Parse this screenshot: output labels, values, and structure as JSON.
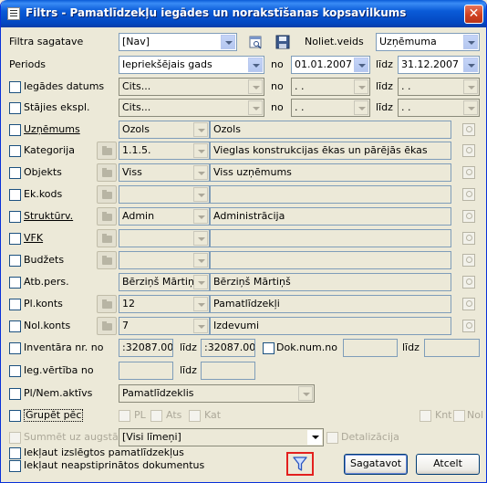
{
  "window": {
    "title": "Filtrs - Pamatlīdzekļu iegādes un norakstīšanas kopsavilkums",
    "close_glyph": "✕"
  },
  "filtra_sagatave": {
    "label": "Filtra sagatave",
    "value": "[Nav]"
  },
  "noliet_veids": {
    "label": "Noliet.veids",
    "value": "Uzņēmuma"
  },
  "periods": {
    "label": "Periods",
    "value": "Iepriekšējais gads",
    "no_label": "no",
    "from": "01.01.2007",
    "lidz_label": "līdz",
    "to": "31.12.2007"
  },
  "iegades_datums": {
    "label": "Iegādes datums",
    "value": "Cits...",
    "no_label": "no",
    "from": " .  . ",
    "lidz_label": "līdz",
    "to": " .  . "
  },
  "stajies_ekspl": {
    "label": "Stājies ekspl.",
    "value": "Cits...",
    "no_label": "no",
    "from": " .  . ",
    "lidz_label": "līdz",
    "to": " .  . "
  },
  "rows": {
    "uznemums": {
      "label": "Uzņēmums",
      "code": "Ozols",
      "name": "Ozols"
    },
    "kategorija": {
      "label": "Kategorija",
      "code": "1.1.5.",
      "name": "Vieglas konstrukcijas ēkas un pārējās ēkas"
    },
    "objekts": {
      "label": "Objekts",
      "code": "Viss",
      "name": "Viss uzņēmums"
    },
    "ek_kods": {
      "label": "Ek.kods",
      "code": "",
      "name": ""
    },
    "strukturv": {
      "label": "Struktūrv.",
      "code": "Admin",
      "name": "Administrācija"
    },
    "vfk": {
      "label": "VFK",
      "code": "",
      "name": ""
    },
    "budzets": {
      "label": "Budžets",
      "code": "",
      "name": ""
    },
    "atb_pers": {
      "label": "Atb.pers.",
      "code": "Bērziņš Mārtiņš",
      "name": "Bērziņš Mārtiņš"
    },
    "pl_konts": {
      "label": "Pl.konts",
      "code": "12",
      "name": "Pamatlīdzekļi"
    },
    "nol_konts": {
      "label": "Nol.konts",
      "code": "7",
      "name": "Izdevumi"
    }
  },
  "inventara_nr": {
    "label": "Inventāra nr. no",
    "from": ":32087.000",
    "lidz_label": "līdz",
    "to": ":32087.000"
  },
  "dok_num": {
    "label": "Dok.num.no",
    "from": "",
    "lidz_label": "līdz",
    "to": ""
  },
  "ieg_vertiba": {
    "label": "Ieg.vērtība no",
    "from": "",
    "lidz_label": "līdz",
    "to": ""
  },
  "pl_nem_aktivs": {
    "label": "Pl/Nem.aktīvs",
    "value": "Pamatlīdzeklis"
  },
  "grupet_pec": {
    "label": "Grupēt pēc",
    "opt_pl": "PL",
    "opt_ats": "Ats",
    "opt_kat": "Kat",
    "opt_knt": "Knt",
    "opt_nol": "Nol"
  },
  "summet": {
    "label": "Summēt uz augstāko",
    "value": "[Visi līmeņi]",
    "detalizacija": "Detalizācija"
  },
  "iekl_izslegtos": {
    "label": "Iekļaut izslēgtos pamatlīdzekļus"
  },
  "iekl_neapst": {
    "label": "Iekļaut neapstiprinātos dokumentus"
  },
  "buttons": {
    "sagatavot": "Sagatavot",
    "atcelt": "Atcelt"
  }
}
